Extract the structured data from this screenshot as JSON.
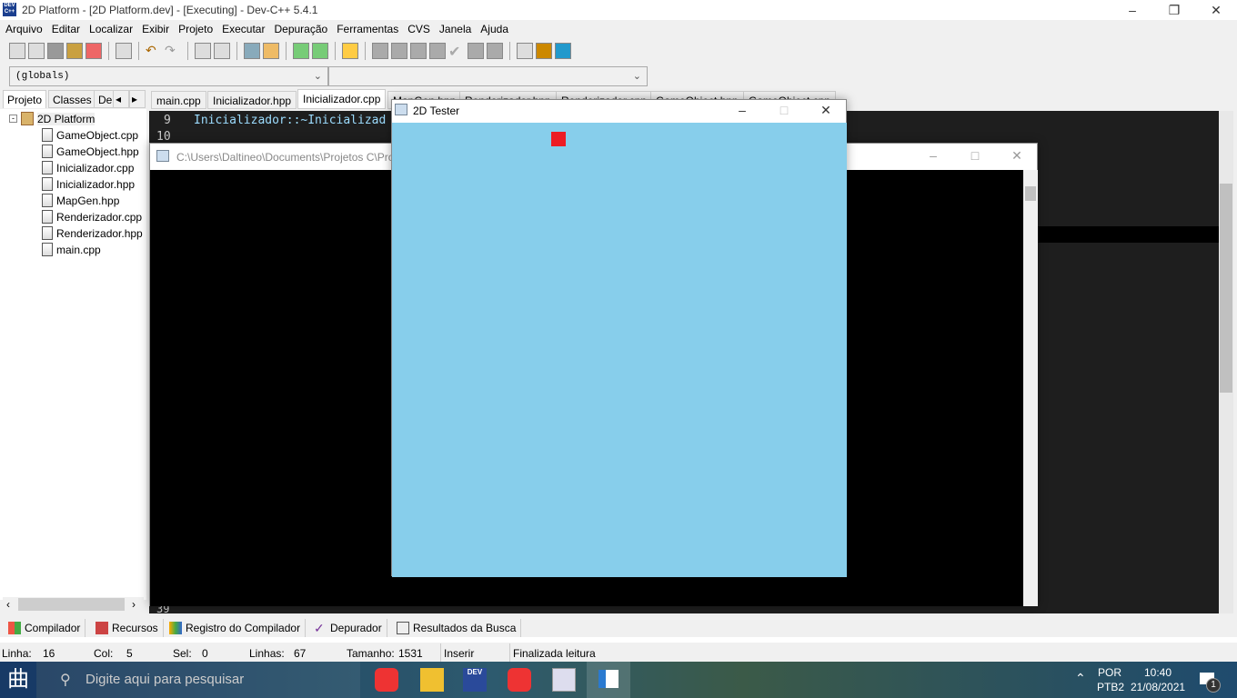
{
  "title": "2D Platform - [2D Platform.dev] - [Executing] - Dev-C++ 5.4.1",
  "menu": [
    "Arquivo",
    "Editar",
    "Localizar",
    "Exibir",
    "Projeto",
    "Executar",
    "Depuração",
    "Ferramentas",
    "CVS",
    "Janela",
    "Ajuda"
  ],
  "combo": {
    "left": "(globals)",
    "right": ""
  },
  "left_tabs": [
    "Projeto",
    "Classes",
    "De"
  ],
  "tree": {
    "root": "2D Platform",
    "files": [
      "GameObject.cpp",
      "GameObject.hpp",
      "Inicializador.cpp",
      "Inicializador.hpp",
      "MapGen.hpp",
      "Renderizador.cpp",
      "Renderizador.hpp",
      "main.cpp"
    ]
  },
  "editor_tabs": [
    "main.cpp",
    "Inicializador.hpp",
    "Inicializador.cpp",
    "MapGen.hpp",
    "Renderizador.hpp",
    "Renderizador.cpp",
    "GameObject.hpp",
    "GameObject.cpp"
  ],
  "active_tab": "Inicializador.cpp",
  "code": [
    {
      "n": "9",
      "text": "Inicializador::~Inicializad"
    },
    {
      "n": "10",
      "text": ""
    }
  ],
  "bottom_line_number": "39",
  "console": {
    "title": "C:\\Users\\Daltineo\\Documents\\Projetos C\\Pro"
  },
  "game": {
    "title": "2D Tester",
    "bg": "#87CEEB",
    "player_color": "#ED1C24"
  },
  "bottom_tabs": [
    "Compilador",
    "Recursos",
    "Registro do Compilador",
    "Depurador",
    "Resultados da Busca"
  ],
  "status": {
    "linha_label": "Linha:",
    "linha": "16",
    "col_label": "Col:",
    "col": "5",
    "sel_label": "Sel:",
    "sel": "0",
    "linhas_label": "Linhas:",
    "linhas": "67",
    "tamanho_label": "Tamanho:",
    "tamanho": "1531",
    "mode": "Inserir",
    "message": "Finalizada leitura"
  },
  "taskbar": {
    "search_placeholder": "Digite aqui para pesquisar",
    "lang1": "POR",
    "lang2": "PTB2",
    "time": "10:40",
    "date": "21/08/2021",
    "notifications": "1"
  }
}
